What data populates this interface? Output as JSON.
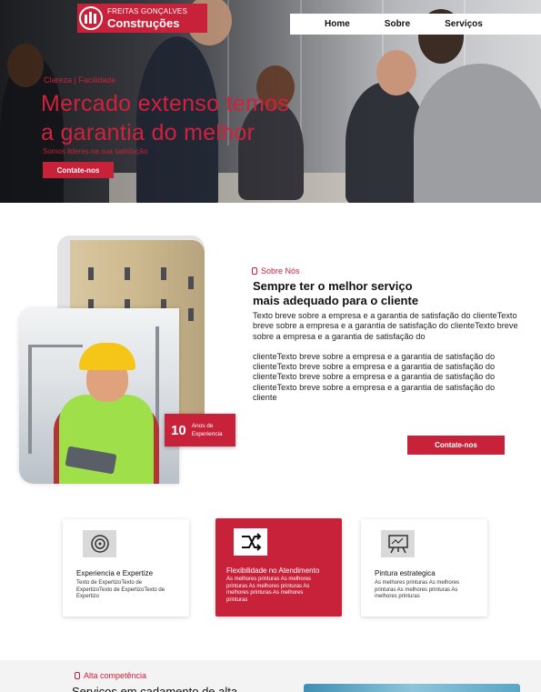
{
  "brand": {
    "top": "FREITAS GONÇALVES",
    "bottom": "Construções",
    "color": "#c8213a"
  },
  "nav": {
    "items": [
      "Home",
      "Sobre",
      "Serviços"
    ]
  },
  "hero": {
    "tag": "Clareza | Facilidade",
    "title_line1": "Mercado extenso temos",
    "title_line2": "a garantia do melhor",
    "subtitle": "Somos lideres na sua satisfação",
    "cta": "Contate-nos"
  },
  "about": {
    "eyebrow": "Sobre Nós",
    "title_line1": "Sempre ter o melhor serviço",
    "title_line2": "mais adequado para o cliente",
    "paragraph1": "Texto breve sobre a empresa e a garantia de satisfação do clienteTexto breve sobre a empresa e a garantia de satisfação do clienteTexto breve sobre a empresa e a garantia de satisfação do",
    "paragraph2": "clienteTexto breve sobre a empresa e a garantia de satisfação do clienteTexto breve sobre a empresa e a garantia de satisfação do clienteTexto breve sobre a empresa e a garantia de satisfação do clienteTexto breve sobre a empresa e a garantia de satisfação do cliente",
    "badge_number": "10",
    "badge_line1": "Anos de",
    "badge_line2": "Experiencia",
    "cta": "Contate-nos"
  },
  "features": [
    {
      "icon": "target-icon",
      "title": "Experiencia e Expertize",
      "text": "Texto de ExpertizoTexto de ExpertizoTexto de ExpertizoTexto de Expertizo"
    },
    {
      "icon": "arrows-icon",
      "title": "Flexibilidade no Atendimento",
      "text": "As melhores printuras As melhores printuras As melhores printuras As melhores printuras As melhores printuras"
    },
    {
      "icon": "easel-icon",
      "title": "Pintura estrategica",
      "text": "As melhores printuras As melhores printuras As melhores printuras As melhores printuras"
    }
  ],
  "competence": {
    "eyebrow": "Alta competência",
    "title": "Serviços em cadamento de alta"
  }
}
